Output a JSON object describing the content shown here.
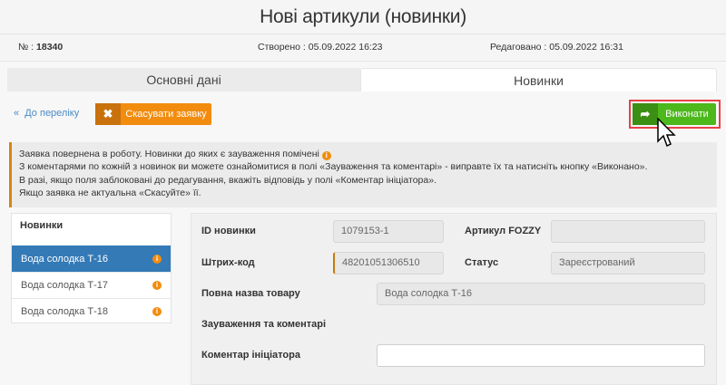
{
  "header": {
    "title": "Нові артикули (новинки)"
  },
  "info": {
    "number_label": "№ : ",
    "number": "18340",
    "created": "Створено : 05.09.2022 16:23",
    "edited": "Редаговано : 05.09.2022 16:31"
  },
  "tabs": [
    {
      "label": "Основні дані",
      "active": false
    },
    {
      "label": "Новинки",
      "active": true
    }
  ],
  "toolbar": {
    "back": "До переліку",
    "cancel": "Скасувати заявку",
    "execute": "Виконати"
  },
  "alert": {
    "lines": [
      "Заявка повернена в роботу. Новинки до яких є зауваження помічені",
      "З коментарями по кожній з новинок ви можете ознайомитися в полі «Зауваження та коментарі» - виправте їх та натисніть кнопку «Виконано».",
      "В разі, якщо поля заблоковані до редагування, вкажіть відповідь у полі «Коментар ініціатора».",
      "Якщо заявка не актуальна «Скасуйте» її."
    ]
  },
  "list": {
    "title": "Новинки",
    "items": [
      {
        "label": "Вода солодка Т-16",
        "active": true
      },
      {
        "label": "Вода солодка Т-17"
      },
      {
        "label": "Вода солодка Т-18"
      }
    ]
  },
  "form": {
    "id_label": "ID новинки",
    "id_value": "1079153-1",
    "fozzy_label": "Артикул FOZZY",
    "fozzy_value": "",
    "barcode_label": "Штрих-код",
    "barcode_value": "48201051306510",
    "status_label": "Статус",
    "status_value": "Зареєстрований",
    "fullname_label": "Повна назва товару",
    "fullname_value": "Вода солодка Т-16",
    "remarks_label": "Зауваження та коментарі",
    "comment_label": "Коментар ініціатора",
    "comment_value": ""
  },
  "colors": {
    "primary": "#337ab7",
    "warning": "#f28c0e",
    "success": "#4cb81b",
    "highlight": "#e8414a"
  }
}
